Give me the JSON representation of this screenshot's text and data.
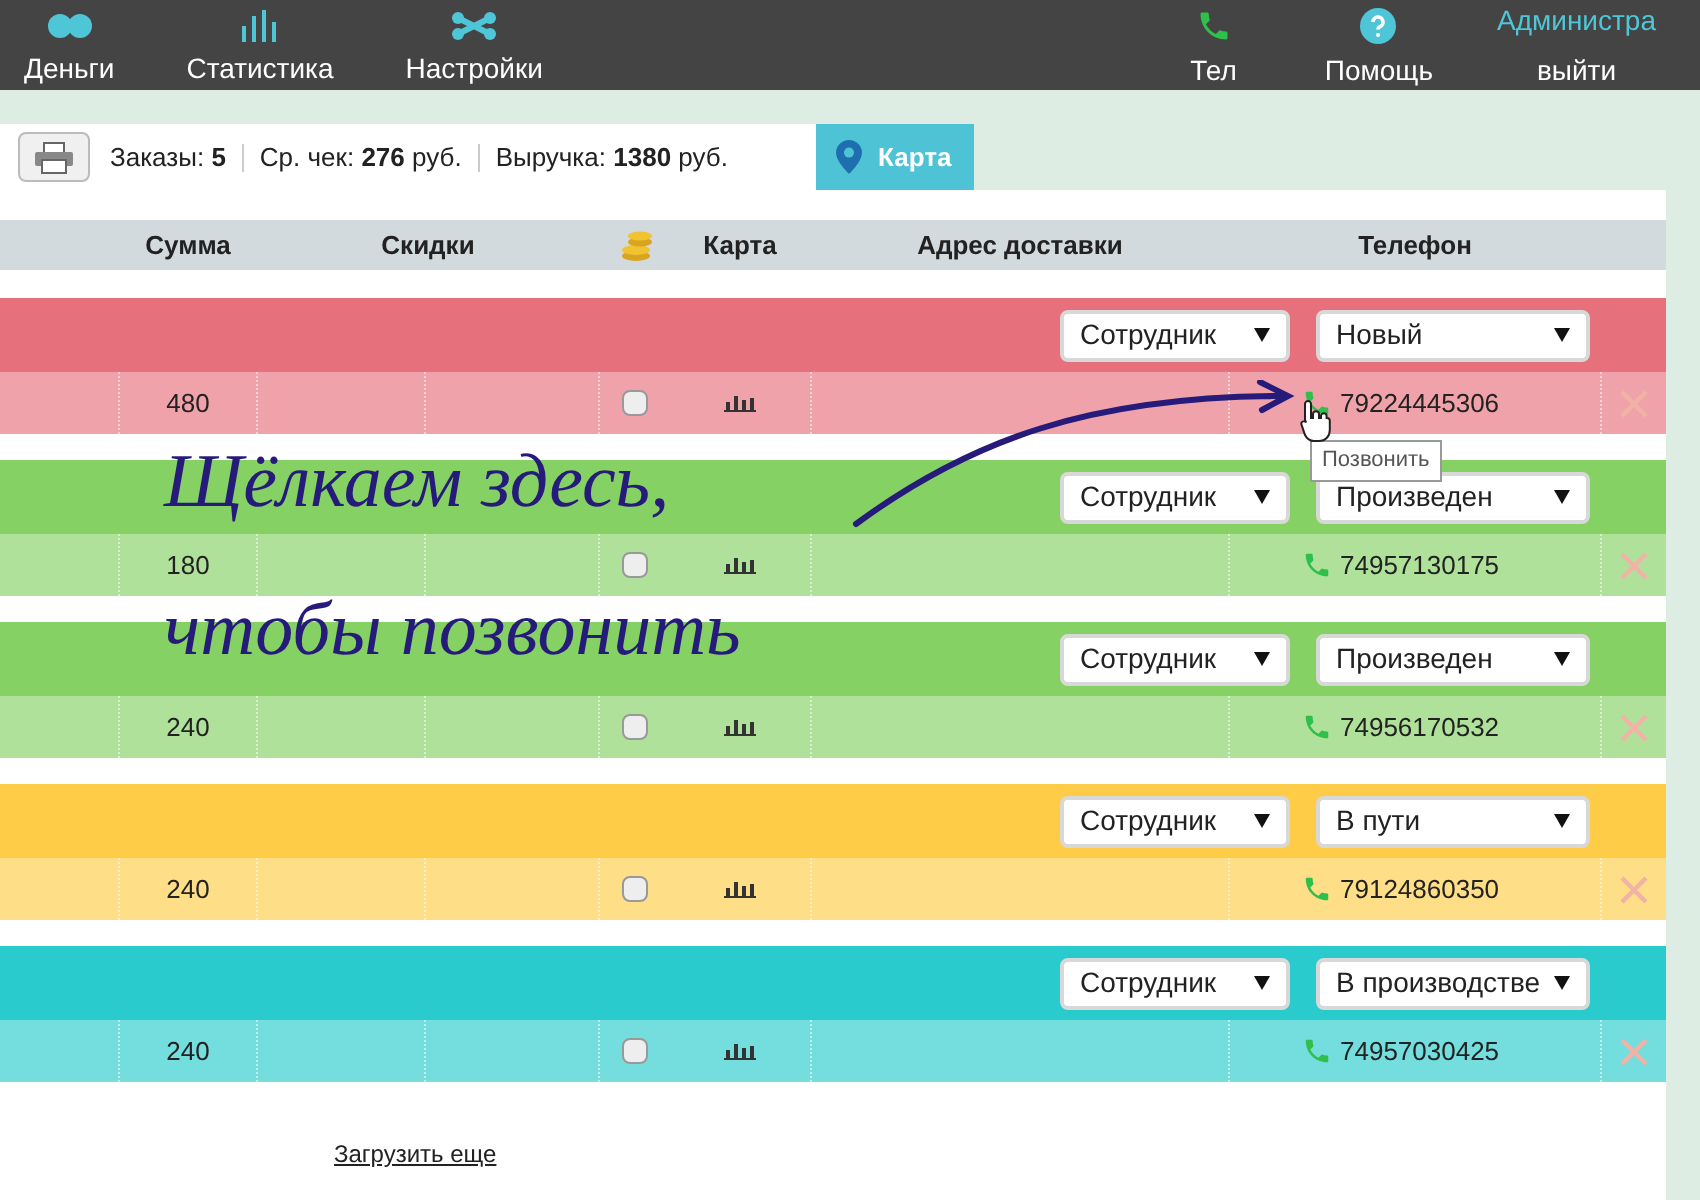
{
  "nav": {
    "left": [
      {
        "label": "Деньги",
        "kind": "money"
      },
      {
        "label": "Статистика",
        "kind": "stats"
      },
      {
        "label": "Настройки",
        "kind": "settings"
      }
    ],
    "right": [
      {
        "label": "Тел",
        "kind": "phone"
      },
      {
        "label": "Помощь",
        "kind": "help"
      }
    ],
    "user": {
      "name": "Администра",
      "logout": "выйти"
    }
  },
  "toolbar": {
    "stats": [
      {
        "label": "Заказы:",
        "value": "5"
      },
      {
        "label": "Ср. чек:",
        "value": "276",
        "unit": "руб."
      },
      {
        "label": "Выручка:",
        "value": "1380",
        "unit": "руб."
      }
    ],
    "map_tab": "Карта"
  },
  "columns": [
    "Сумма",
    "Скидки",
    "Карта",
    "Адрес доставки",
    "Телефон"
  ],
  "orders": [
    {
      "color": "#e6707c",
      "employee": "Сотрудник",
      "status": "Новый",
      "sum": "480",
      "checked": false,
      "phone": "79224445306"
    },
    {
      "color": "#86d164",
      "employee": "Сотрудник",
      "status": "Произведен",
      "sum": "180",
      "checked": false,
      "phone": "74957130175"
    },
    {
      "color": "#86d164",
      "employee": "Сотрудник",
      "status": "Произведен",
      "sum": "240",
      "checked": false,
      "phone": "74956170532"
    },
    {
      "color": "#fecc46",
      "employee": "Сотрудник",
      "status": "В пути",
      "sum": "240",
      "checked": false,
      "phone": "79124860350"
    },
    {
      "color": "#2acbcd",
      "employee": "Сотрудник",
      "status": "В производстве",
      "sum": "240",
      "checked": false,
      "phone": "74957030425"
    }
  ],
  "tooltip": "Позвонить",
  "load_more": "Загрузить еще",
  "annotation": [
    "Щёлкаем здесь,",
    "чтобы позвонить"
  ]
}
